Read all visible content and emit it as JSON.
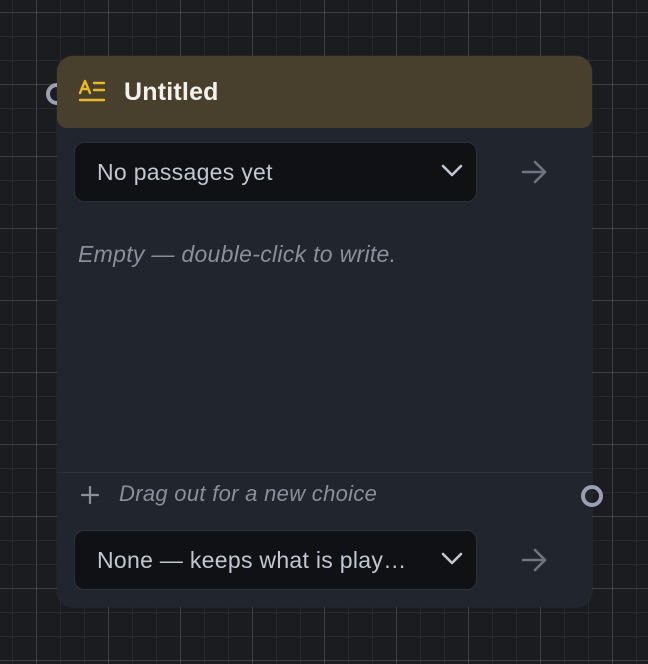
{
  "node": {
    "title": "Untitled",
    "header_icon": "text-passage-icon",
    "colors": {
      "header": "#48402c",
      "accent": "#e8b928",
      "body": "#21252d",
      "port": "#9aa0b3"
    }
  },
  "passage_select": {
    "value": "No passages yet",
    "icon": "chevron-down-icon",
    "go_icon": "arrow-right-icon"
  },
  "content": {
    "placeholder": "Empty — double-click to write."
  },
  "add_choice": {
    "icon": "plus-icon",
    "label": "Drag out for a new choice"
  },
  "music_select": {
    "value": "None — keeps what is play…",
    "icon": "chevron-down-icon",
    "go_icon": "arrow-right-icon"
  }
}
